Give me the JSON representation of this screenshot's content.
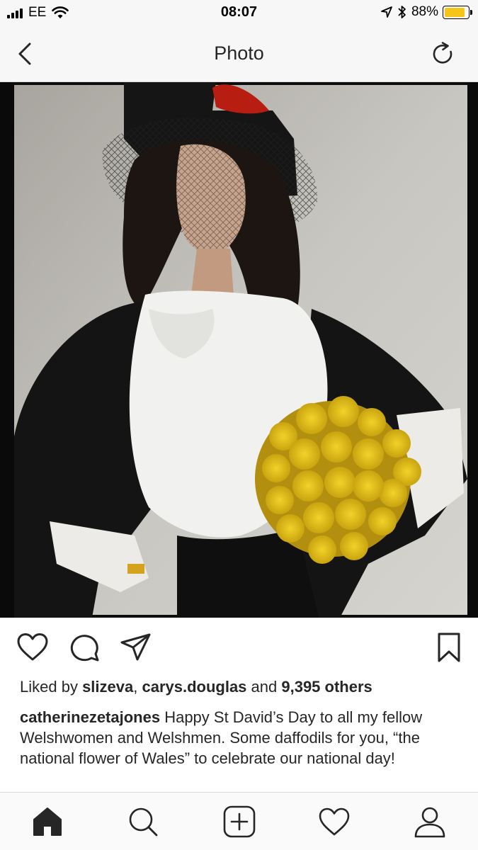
{
  "status_bar": {
    "carrier": "EE",
    "time": "08:07",
    "battery_percent": "88%",
    "battery_level": 0.88,
    "icons": [
      "signal-icon",
      "wifi-icon",
      "location-arrow-icon",
      "bluetooth-icon",
      "battery-icon"
    ]
  },
  "nav": {
    "title": "Photo",
    "back_icon": "chevron-left-icon",
    "refresh_icon": "refresh-icon"
  },
  "actions": {
    "icons": [
      "heart-icon",
      "comment-icon",
      "send-icon",
      "bookmark-icon"
    ]
  },
  "likes": {
    "prefix": "Liked by ",
    "user1": "slizeva",
    "separator": ", ",
    "user2": "carys.douglas",
    "middle": " and ",
    "others": "9,395 others"
  },
  "caption": {
    "username": "catherinezetajones",
    "text": " Happy St David’s Day to all my fellow Welshwomen and Welshmen. Some daffodils for you, “the national flower of Wales” to celebrate our national day!"
  },
  "tab_bar": {
    "icons": [
      "home-icon",
      "search-icon",
      "add-post-icon",
      "activity-heart-icon",
      "profile-icon"
    ]
  },
  "colors": {
    "battery_fill": "#f5c518",
    "text": "#262626",
    "bar_background": "#f7f7f7"
  }
}
